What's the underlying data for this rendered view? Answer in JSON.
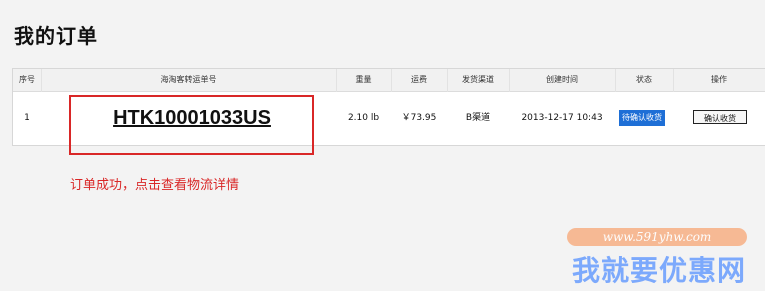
{
  "page": {
    "title": "我的订单"
  },
  "table": {
    "headers": {
      "index": "序号",
      "tracking_no": "海淘客转运单号",
      "weight": "重量",
      "shipping_fee": "运费",
      "channel": "发货渠道",
      "created_time": "创建时间",
      "status": "状态",
      "action": "操作"
    },
    "rows": [
      {
        "index": "1",
        "tracking_no": "HTK10001033US",
        "weight": "2.10 lb",
        "shipping_fee": "￥73.95",
        "channel": "B渠道",
        "created_time": "2013-12-17 10:43",
        "status": "待确认收货",
        "action_label": "确认收货"
      }
    ]
  },
  "annotation": {
    "text": "订单成功，点击查看物流详情"
  },
  "watermark": {
    "url": "www.591yhw.com",
    "name": "我就要优惠网"
  }
}
